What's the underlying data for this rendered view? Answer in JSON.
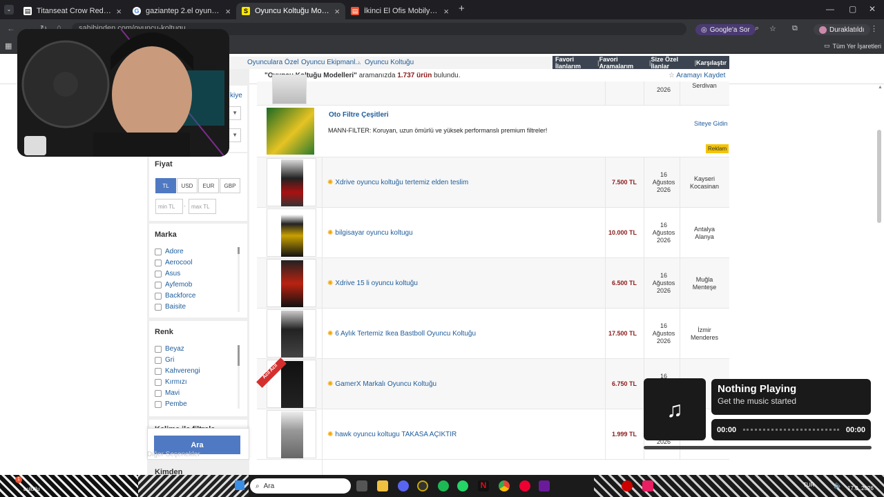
{
  "browser": {
    "tabs": [
      {
        "title": "Titanseat Crow Red Kumaş Oyu",
        "icon": "tab-page-icon"
      },
      {
        "title": "gaziantep 2.el oyuncu koltuğu",
        "icon": "google-icon"
      },
      {
        "title": "Oyuncu Koltuğu Modelleri & Fi",
        "icon": "sahibinden-icon"
      },
      {
        "title": "İkinci El Ofis Mobilyaları İlanla",
        "icon": "tab-page-icon"
      }
    ],
    "url": "sahibinden.com/oyuncu-koltugu",
    "google_button": "Google'a Sor",
    "profile_button": "Duraklatıldı",
    "all_bookmarks": "Tüm Yer İşaretleri"
  },
  "breadcrumb": [
    "Oyunculara Özel",
    "Oyuncu Ekipmanl...",
    "Oyuncu Koltuğu"
  ],
  "top_links": [
    "Favori İlanlarım",
    "Favori Aramalarım",
    "Size Özel İlanlar",
    "Karşılaştır"
  ],
  "search_info": {
    "query": "\"Oyuncu Koltuğu Modelleri\"",
    "middle": " aramanızda ",
    "count": "1.737 ürün",
    "end": " bulundu."
  },
  "save_search": "Aramayı Kaydet",
  "sidebar": {
    "partial_link": "kiye",
    "price_title": "Fiyat",
    "currencies": [
      "TL",
      "USD",
      "EUR",
      "GBP"
    ],
    "min_placeholder": "min TL",
    "max_placeholder": "max TL",
    "dash": "-",
    "brand_title": "Marka",
    "brands": [
      "Adore",
      "Aerocool",
      "Asus",
      "Ayfemob",
      "Backforce",
      "Baisite"
    ],
    "color_title": "Renk",
    "colors": [
      "Beyaz",
      "Gri",
      "Kahverengi",
      "Kırmızı",
      "Mavi",
      "Pembe"
    ],
    "keyword_title": "Kelime ile filtrele",
    "other_title": "Diğer Seçenekler",
    "search_button": "Ara",
    "from_title": "Kimden"
  },
  "partial_top_row": {
    "date": "2026",
    "loc": "Serdivan"
  },
  "ad": {
    "title": "Oto Filtre Çeşitleri",
    "description": "MANN-FILTER: Koruyan, uzun ömürlü ve yüksek performanslı premium filtreler!",
    "link": "Siteye Gidin",
    "badge": "Reklam"
  },
  "listings": [
    {
      "title": "Xdrive oyuncu koltuğu tertemiz elden teslim",
      "price": "7.500 TL",
      "date": [
        "16",
        "Ağustos",
        "2026"
      ],
      "loc": [
        "Kayseri",
        "Kocasinan"
      ]
    },
    {
      "title": "bilgisayar oyuncu koltugu",
      "price": "10.000 TL",
      "date": [
        "16",
        "Ağustos",
        "2026"
      ],
      "loc": [
        "Antalya",
        "Alanya"
      ]
    },
    {
      "title": "Xdrive 15 li oyuncu koltuğu",
      "price": "6.500 TL",
      "date": [
        "16",
        "Ağustos",
        "2026"
      ],
      "loc": [
        "Muğla",
        "Menteşe"
      ]
    },
    {
      "title": "6 Aylık Tertemiz Ikea Bastboll Oyuncu Koltuğu",
      "price": "17.500 TL",
      "date": [
        "16",
        "Ağustos",
        "2026"
      ],
      "loc": [
        "İzmir",
        "Menderes"
      ]
    },
    {
      "title": "GamerX Markalı Oyuncu Koltuğu",
      "price": "6.750 TL",
      "date": [
        "16",
        "",
        ""
      ],
      "loc": [
        "",
        ""
      ],
      "badge": "Acil Acil"
    },
    {
      "title": "hawk oyuncu koltugu TAKASA AÇIKTIR",
      "price": "1.999 TL",
      "date": [
        "",
        "",
        "2026"
      ],
      "loc": [
        "",
        ""
      ]
    }
  ],
  "music": {
    "title": "Nothing Playing",
    "subtitle": "Get the music started",
    "time_start": "00:00",
    "time_end": "00:00"
  },
  "taskbar": {
    "search": "Ara",
    "weather": "bulutlu",
    "time": "17.0..2026",
    "lang": "TUR"
  }
}
